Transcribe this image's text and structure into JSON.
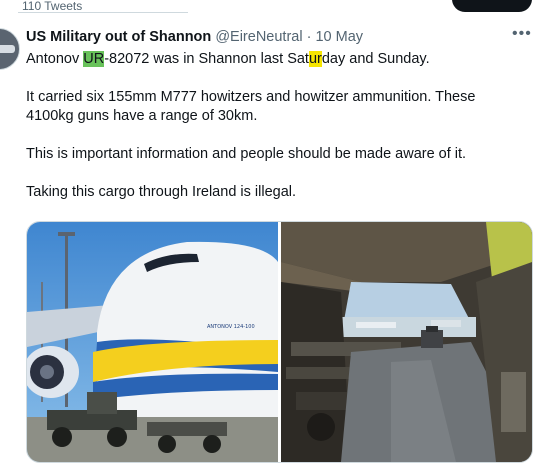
{
  "profile": {
    "tweet_count": "110 Tweets"
  },
  "tweet": {
    "author_name": "US Military out of Shannon",
    "author_handle": "@EireNeutral",
    "separator": "·",
    "date": "10 May",
    "more_glyph": "•••",
    "line1": {
      "part1": "Antonov ",
      "highlight1": "UR",
      "part2": "-82072 was in Shannon last Sat",
      "highlight2": "ur",
      "part3": "day and Sunday."
    },
    "paragraph2": "It carried six 155mm M777 howitzers and howitzer ammunition. These 4100kg guns have a range of 30km.",
    "paragraph3": "This is important information and people should be made aware of it.",
    "paragraph4": "Taking this cargo through Ireland is illegal."
  },
  "media": {
    "left_photo_icon": "antonov-plane-photo",
    "right_photo_icon": "cargo-hold-photo",
    "fuselage_text": "ANTONOV 124-100"
  },
  "colors": {
    "highlight_green": "#68c25a",
    "highlight_yellow": "#f6e500",
    "secondary_text": "#536471",
    "primary_text": "#0f1419"
  }
}
